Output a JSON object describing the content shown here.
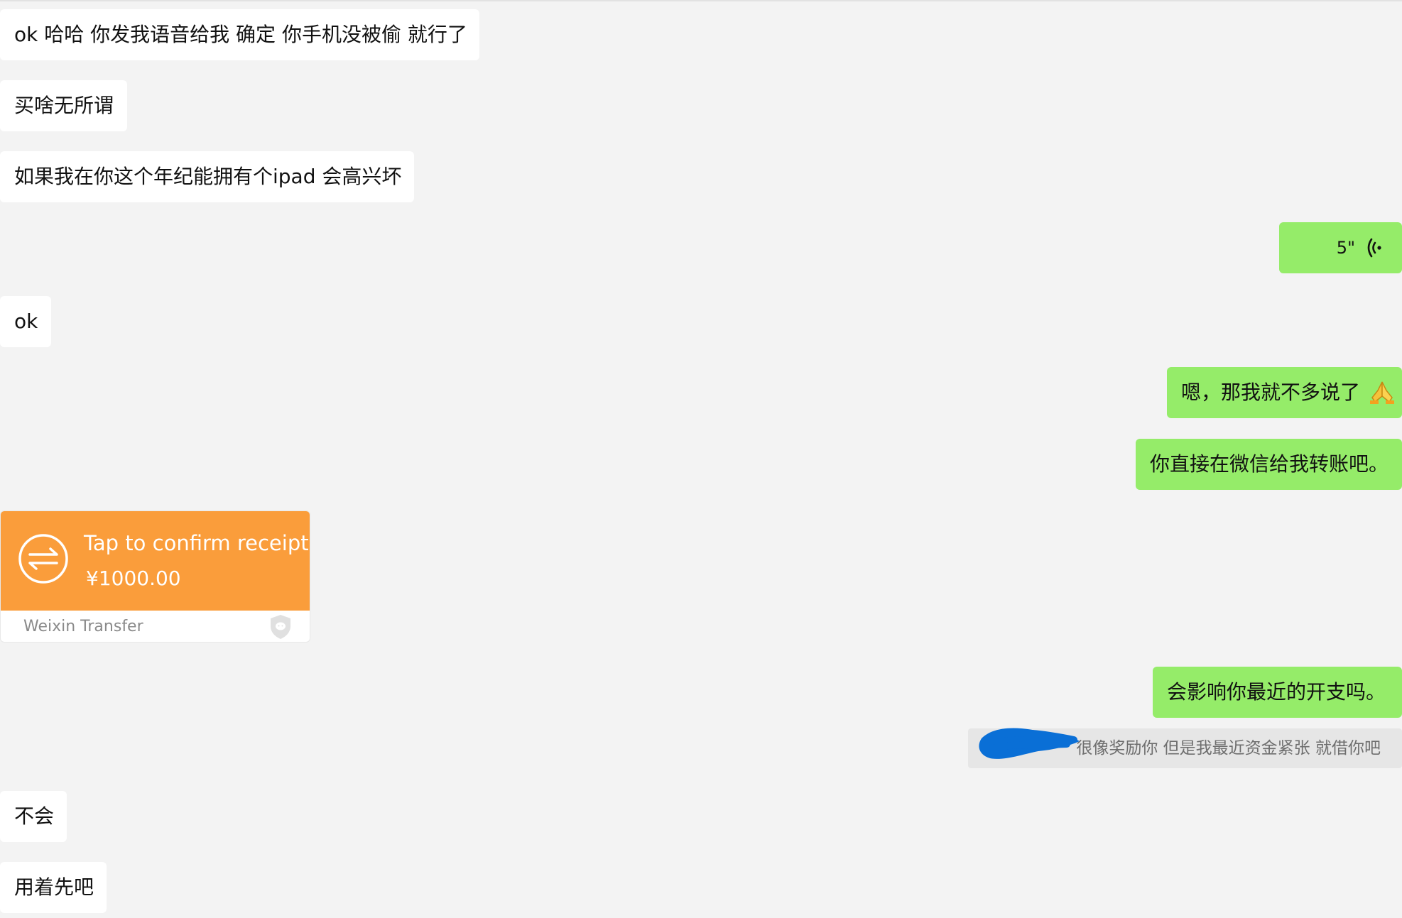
{
  "messages": [
    {
      "side": "received",
      "text": "ok 哈哈 你发我语音给我 确定 你手机没被偷 就行了"
    },
    {
      "side": "received",
      "text": "买啥无所谓"
    },
    {
      "side": "received",
      "text": "如果我在你这个年纪能拥有个ipad 会高兴坏"
    },
    {
      "side": "sent",
      "type": "voice",
      "duration": "5\""
    },
    {
      "side": "received",
      "text": "ok"
    },
    {
      "side": "sent",
      "text": "嗯，那我就不多说了",
      "emoji": "pray-hands-icon"
    },
    {
      "side": "sent",
      "text": "你直接在微信给我转账吧。"
    },
    {
      "side": "sent",
      "text": "会影响你最近的开支吗。"
    },
    {
      "side": "received",
      "text": "不会"
    },
    {
      "side": "received",
      "text": "用着先吧"
    }
  ],
  "transfer": {
    "title": "Tap to confirm receipt",
    "amount": "¥1000.00",
    "footer": "Weixin Transfer",
    "icon": "transfer-arrows-icon",
    "color": "#fa9d3b"
  },
  "quote": {
    "text": "很像奖励你 但是我最近资金紧张 就借你吧",
    "redaction_color": "#0a6fd6"
  },
  "colors": {
    "background": "#f3f3f3",
    "sent_bubble": "#95ec69",
    "received_bubble": "#ffffff"
  }
}
